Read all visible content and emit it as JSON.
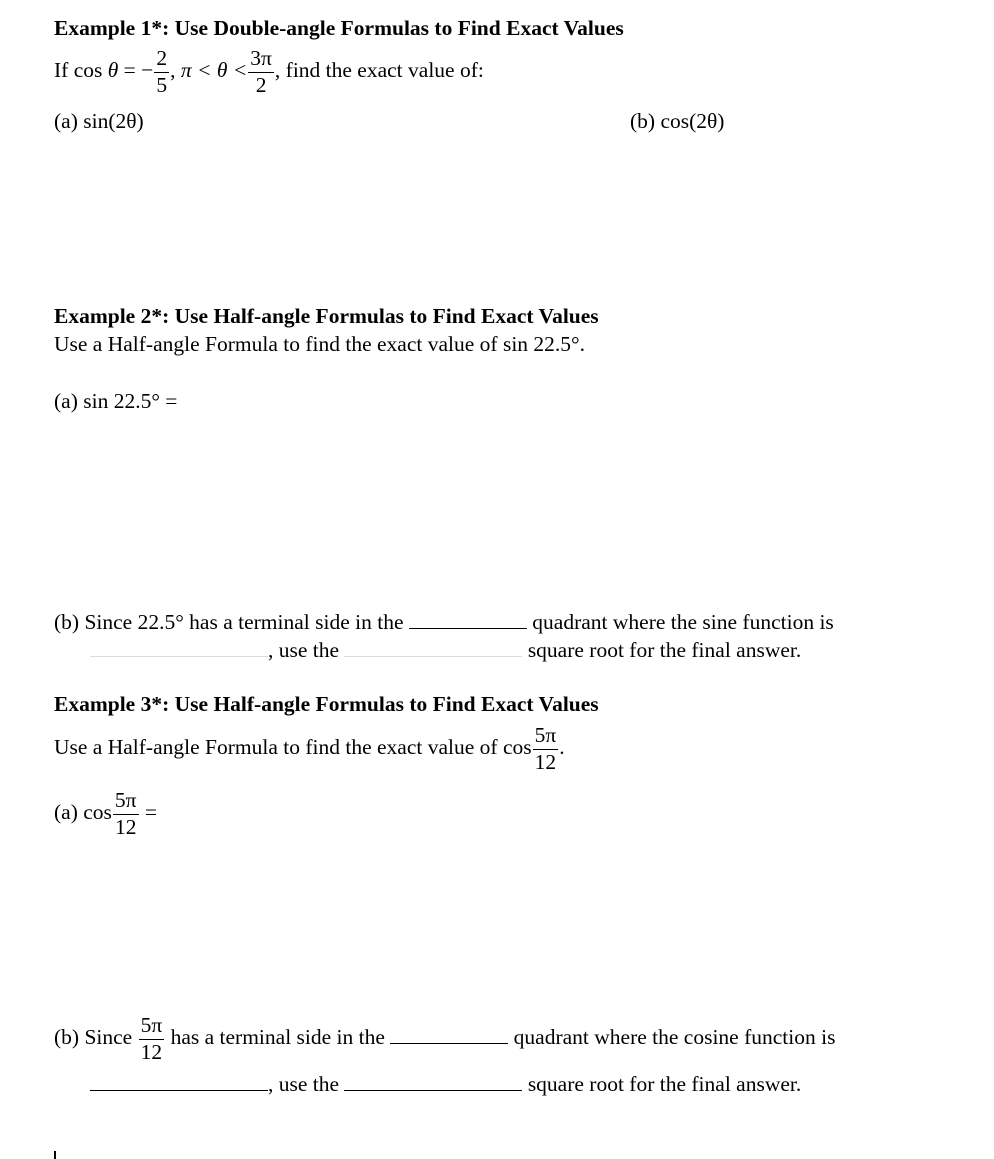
{
  "example1": {
    "title": "Example 1*: Use Double-angle Formulas to Find Exact Values",
    "given_prefix": "If cos",
    "theta": "θ",
    "equals_neg": " = −",
    "frac1_num": "2",
    "frac1_den": "5",
    "comma1": ",",
    "range_text": "π < θ <",
    "frac2_num": "3π",
    "frac2_den": "2",
    "given_suffix": ", find the exact value of:",
    "part_a": "(a) sin(2θ)",
    "part_b": "(b) cos(2θ)"
  },
  "example2": {
    "title": "Example 2*: Use Half-angle Formulas to Find Exact Values",
    "prompt": "Use a Half-angle Formula to find the exact value of",
    "prompt_expr": "sin 22.5°",
    "prompt_end": ".",
    "part_a": "(a) sin 22.5° =",
    "part_b_line1_start": "(b) Since 22.5° has a terminal side in the",
    "part_b_line1_end": "quadrant where the sine function is",
    "part_b_line2_mid": ", use the",
    "part_b_line2_end": "square root for the final answer."
  },
  "example3": {
    "title": "Example 3*: Use Half-angle Formulas to Find Exact Values",
    "prompt": "Use a Half-angle Formula to find the exact value of",
    "cos": "cos",
    "frac_num": "5π",
    "frac_den": "12",
    "prompt_end": ".",
    "part_a_label": "(a)",
    "part_a_equals": "=",
    "part_b_start": "(b) Since",
    "part_b_line1_mid": "has a terminal side in the",
    "part_b_line1_end": "quadrant where the cosine function is",
    "part_b_line2_mid": ", use the",
    "part_b_line2_end": "square root for the final answer."
  }
}
